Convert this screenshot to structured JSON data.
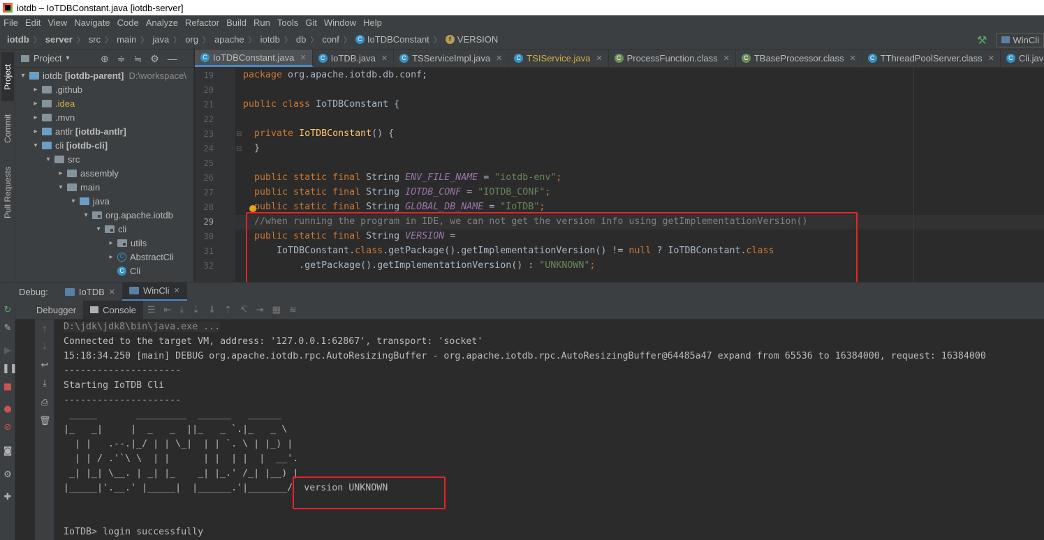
{
  "titlebar": {
    "title": "iotdb – IoTDBConstant.java [iotdb-server]"
  },
  "menu": [
    "File",
    "Edit",
    "View",
    "Navigate",
    "Code",
    "Analyze",
    "Refactor",
    "Build",
    "Run",
    "Tools",
    "Git",
    "Window",
    "Help"
  ],
  "breadcrumbs": [
    "iotdb",
    "server",
    "src",
    "main",
    "java",
    "org",
    "apache",
    "iotdb",
    "db",
    "conf",
    "IoTDBConstant",
    "VERSION"
  ],
  "run_config": "WinCli",
  "left_tabs": {
    "project": "Project",
    "commit": "Commit",
    "pull_requests": "Pull Requests"
  },
  "project_panel": {
    "title": "Project",
    "tree": [
      {
        "label": "iotdb",
        "module": "[iotdb-parent]",
        "path": "D:\\workspace\\",
        "arrow": "▾"
      },
      {
        "label": ".github",
        "arrow": "▸"
      },
      {
        "label": ".idea",
        "arrow": "▸"
      },
      {
        "label": ".mvn",
        "arrow": "▸"
      },
      {
        "label": "antlr",
        "module": "[iotdb-antlr]",
        "arrow": "▸"
      },
      {
        "label": "cli",
        "module": "[iotdb-cli]",
        "arrow": "▾"
      },
      {
        "label": "src",
        "arrow": "▾"
      },
      {
        "label": "assembly",
        "arrow": "▸"
      },
      {
        "label": "main",
        "arrow": "▾"
      },
      {
        "label": "java",
        "arrow": "▾"
      },
      {
        "label": "org.apache.iotdb",
        "arrow": "▾"
      },
      {
        "label": "cli",
        "arrow": "▾"
      },
      {
        "label": "utils",
        "arrow": "▸"
      },
      {
        "label": "AbstractCli",
        "arrow": "▸"
      },
      {
        "label": "Cli",
        "arrow": ""
      }
    ]
  },
  "editor_tabs": [
    {
      "label": "IoTDBConstant.java",
      "active": true
    },
    {
      "label": "IoTDB.java"
    },
    {
      "label": "TSServiceImpl.java"
    },
    {
      "label": "TSIService.java"
    },
    {
      "label": "ProcessFunction.class"
    },
    {
      "label": "TBaseProcessor.class"
    },
    {
      "label": "TThreadPoolServer.class"
    },
    {
      "label": "Cli.java"
    }
  ],
  "code": {
    "line_numbers": [
      "19",
      "20",
      "21",
      "22",
      "23",
      "24",
      "25",
      "26",
      "27",
      "28",
      "29",
      "30",
      "31",
      "32"
    ],
    "l19": [
      "package",
      " org.apache.iotdb.db.conf;"
    ],
    "l21": [
      "public class",
      " IoTDBConstant {"
    ],
    "l23": [
      "private",
      " ",
      "IoTDBConstant",
      "() {"
    ],
    "l24": "}",
    "l26": [
      "public static final",
      " String ",
      "ENV_FILE_NAME",
      " = ",
      "\"iotdb-env\"",
      ";"
    ],
    "l27": [
      "public static final",
      " String ",
      "IOTDB_CONF",
      " = ",
      "\"IOTDB_CONF\"",
      ";"
    ],
    "l28": [
      "public static final",
      " String ",
      "GLOBAL_DB_NAME",
      " = ",
      "\"IoTDB\"",
      ";"
    ],
    "l29": "//when running the program in IDE, we can not get the version info using getImplementationVersion()",
    "l30": [
      "public static final",
      " String ",
      "VERSION",
      " ="
    ],
    "l31": [
      "IoTDBConstant.",
      "class",
      ".getPackage().getImplementationVersion() != ",
      "null",
      " ? IoTDBConstant.",
      "class"
    ],
    "l32": [
      ".getPackage().getImplementationVersion() : ",
      "\"UNKNOWN\"",
      ";"
    ]
  },
  "debug": {
    "label": "Debug:",
    "tabs": [
      {
        "label": "IoTDB"
      },
      {
        "label": "WinCli",
        "active": true
      }
    ],
    "subtabs": {
      "debugger": "Debugger",
      "console": "Console"
    }
  },
  "console_lines": [
    "D:\\jdk\\jdk8\\bin\\java.exe ...",
    "Connected to the target VM, address: '127.0.0.1:62867', transport: 'socket'",
    "15:18:34.250 [main] DEBUG org.apache.iotdb.rpc.AutoResizingBuffer - org.apache.iotdb.rpc.AutoResizingBuffer@64485a47 expand from 65536 to 16384000, request: 16384000",
    "---------------------",
    "Starting IoTDB Cli",
    "---------------------",
    " _____       _________  ______   ______",
    "|_   _|     |  _   _  ||_   _ `.|_   _ \\",
    "  | |   .--.|_/ | | \\_|  | | `. \\ | |_) |",
    "  | | / .'`\\ \\  | |      | |  | |  |  __'.",
    " _| |_| \\__. | _| |_    _| |_.' /_| |__) |",
    "|_____|'.__.' |_____|  |______.'|_______/  version UNKNOWN",
    "",
    "",
    "IoTDB> login successfully"
  ]
}
